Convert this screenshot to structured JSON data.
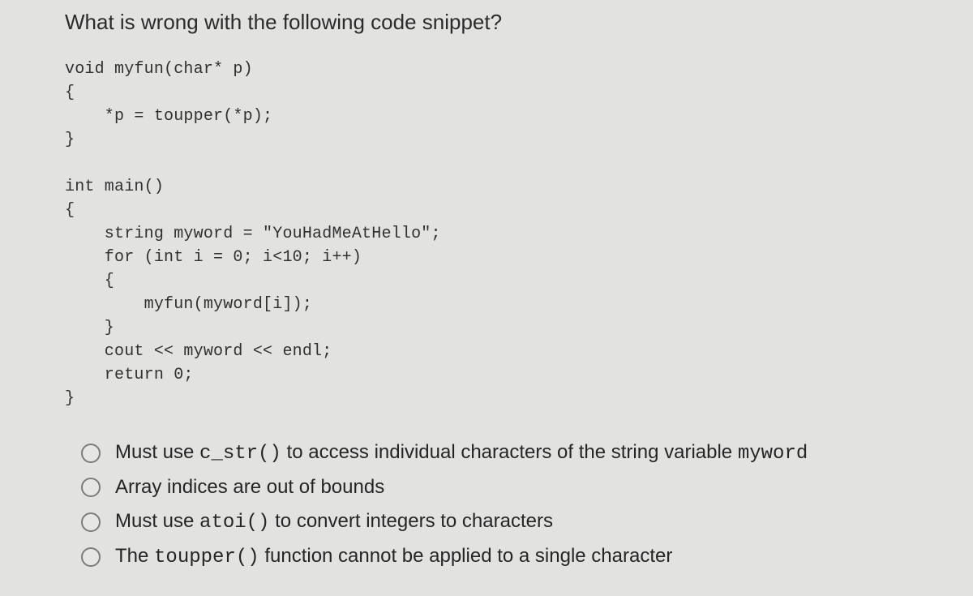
{
  "question": {
    "title": "What is wrong with the following code snippet?",
    "code_lines": [
      "void myfun(char* p)",
      "{",
      "    *p = toupper(*p);",
      "}",
      "",
      "int main()",
      "{",
      "    string myword = \"YouHadMeAtHello\";",
      "    for (int i = 0; i<10; i++)",
      "    {",
      "        myfun(myword[i]);",
      "    }",
      "    cout << myword << endl;",
      "    return 0;",
      "}"
    ]
  },
  "options": [
    {
      "segments": [
        {
          "text": "Must use ",
          "mono": false
        },
        {
          "text": "c_str()",
          "mono": true
        },
        {
          "text": " to access individual characters of the string variable ",
          "mono": false
        },
        {
          "text": "myword",
          "mono": true
        }
      ]
    },
    {
      "segments": [
        {
          "text": "Array indices are out of bounds",
          "mono": false
        }
      ]
    },
    {
      "segments": [
        {
          "text": "Must use ",
          "mono": false
        },
        {
          "text": "atoi()",
          "mono": true
        },
        {
          "text": " to convert integers to characters",
          "mono": false
        }
      ]
    },
    {
      "segments": [
        {
          "text": "The ",
          "mono": false
        },
        {
          "text": "toupper()",
          "mono": true
        },
        {
          "text": " function cannot be applied to a single character",
          "mono": false
        }
      ]
    }
  ]
}
